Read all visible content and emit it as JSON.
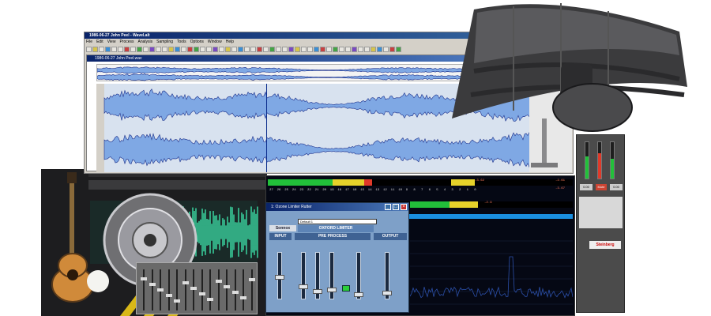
{
  "wavelab": {
    "title": "1986-06-27 John Peel - Wavel.alt",
    "menu": [
      "File",
      "Edit",
      "View",
      "Process",
      "Analysis",
      "Sampling",
      "Tools",
      "Options",
      "Window",
      "Help"
    ],
    "doc_title": "1986-06-27 John Peel.wav"
  },
  "analyzer": {
    "ticks": [
      "27",
      "26",
      "25",
      "24",
      "23",
      "22",
      "21",
      "20",
      "19",
      "18",
      "17",
      "16",
      "15",
      "14",
      "13",
      "12",
      "11",
      "10",
      "9",
      "8",
      "7",
      "6",
      "5",
      "4",
      "3",
      "2",
      "1",
      "0"
    ],
    "readout_1": "-3.62",
    "readout_2": "-2.9",
    "readout_right_1": "-2.61",
    "readout_right_2": "-3.67"
  },
  "limiter": {
    "title": "1: Ozone Limiter Rutter",
    "preset": "Default 1",
    "brand": "Sonnox",
    "sections": [
      "INPUT",
      "PRE PROCESS",
      "OUTPUT"
    ],
    "header": "OXFORD LIMITER"
  },
  "mixer": {
    "btn_1": "0.00",
    "btn_2": "Mute",
    "btn_3": "0.00",
    "logo": "Steinberg"
  },
  "colors": {
    "waveform": "#7fa8e4",
    "waveform_stroke": "#1c2f8a",
    "meter_green": "#22c03a",
    "meter_yellow": "#e6d22a",
    "meter_red": "#e03a2a",
    "spectrum_line": "#2b4fa8",
    "collage_wave": "#3ce0a8"
  }
}
